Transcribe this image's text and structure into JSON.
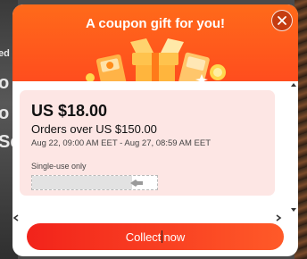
{
  "background": {
    "left_text_lines": [
      "ed",
      "o",
      "o",
      "Se"
    ]
  },
  "modal": {
    "title": "A coupon gift for you!",
    "close_glyph": "✕",
    "coupon": {
      "amount": "US $18.00",
      "condition": "Orders over US $150.00",
      "validity": "Aug 22, 09:00 AM EET - Aug 27, 08:59 AM EET",
      "usage_label": "Single-use only",
      "usage_fill_fraction": 0.8
    },
    "cta": {
      "label_before_caret": "Collect",
      "label_after_caret": "now"
    }
  },
  "colors": {
    "header": "#ff5a1f",
    "coupon_bg": "#fde6e4",
    "cta_start": "#f2231b",
    "cta_end": "#ff5a28"
  },
  "icons": {
    "close": "close-icon",
    "gift": "gift-illustration",
    "cursor": "hand-cursor-icon"
  }
}
